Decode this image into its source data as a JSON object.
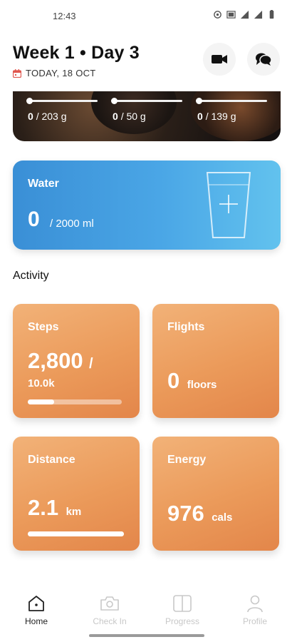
{
  "status": {
    "time": "12:43"
  },
  "header": {
    "title": "Week 1 • Day 3",
    "date": "TODAY, 18 OCT"
  },
  "macros": [
    {
      "current": "0",
      "target": "/ 203 g"
    },
    {
      "current": "0",
      "target": "/ 50 g"
    },
    {
      "current": "0",
      "target": "/ 139 g"
    }
  ],
  "water": {
    "title": "Water",
    "amount": "0",
    "goal": "/ 2000 ml"
  },
  "activity": {
    "section_title": "Activity",
    "steps": {
      "title": "Steps",
      "value": "2,800",
      "slash": "/",
      "goal": "10.0k",
      "progress": 0.28
    },
    "flights": {
      "title": "Flights",
      "value": "0",
      "unit": "floors"
    },
    "distance": {
      "title": "Distance",
      "value": "2.1",
      "unit": "km",
      "progress": 1.0
    },
    "energy": {
      "title": "Energy",
      "value": "976",
      "unit": "cals"
    }
  },
  "nav": [
    {
      "label": "Home",
      "icon": "home-icon",
      "active": true
    },
    {
      "label": "Check In",
      "icon": "camera-icon",
      "active": false
    },
    {
      "label": "Progress",
      "icon": "book-icon",
      "active": false
    },
    {
      "label": "Profile",
      "icon": "person-icon",
      "active": false
    }
  ],
  "colors": {
    "water_gradient_start": "#3a8fd6",
    "water_gradient_end": "#62c2ee",
    "activity_tile": "#eb9a5a",
    "calendar_icon": "#e0574f"
  }
}
